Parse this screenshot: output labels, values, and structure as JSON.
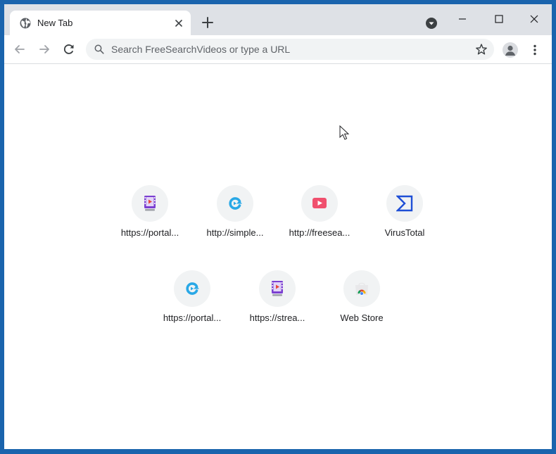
{
  "tab": {
    "title": "New Tab"
  },
  "omnibox": {
    "placeholder": "Search FreeSearchVideos or type a URL"
  },
  "shortcuts": [
    {
      "label": "https://portal...",
      "icon": "video-film-icon"
    },
    {
      "label": "http://simple...",
      "icon": "refresh-arrow-icon"
    },
    {
      "label": "http://freesea...",
      "icon": "play-button-icon"
    },
    {
      "label": "VirusTotal",
      "icon": "virustotal-sigma-icon"
    },
    {
      "label": "https://portal...",
      "icon": "refresh-arrow-icon"
    },
    {
      "label": "https://strea...",
      "icon": "video-film-icon"
    },
    {
      "label": "Web Store",
      "icon": "chrome-web-store-icon"
    }
  ],
  "colors": {
    "desktop_border": "#1a64ad",
    "titlebar": "#dee1e6",
    "omnibox_bg": "#f1f3f4",
    "tile_bg": "#f1f3f4",
    "text": "#202124"
  }
}
